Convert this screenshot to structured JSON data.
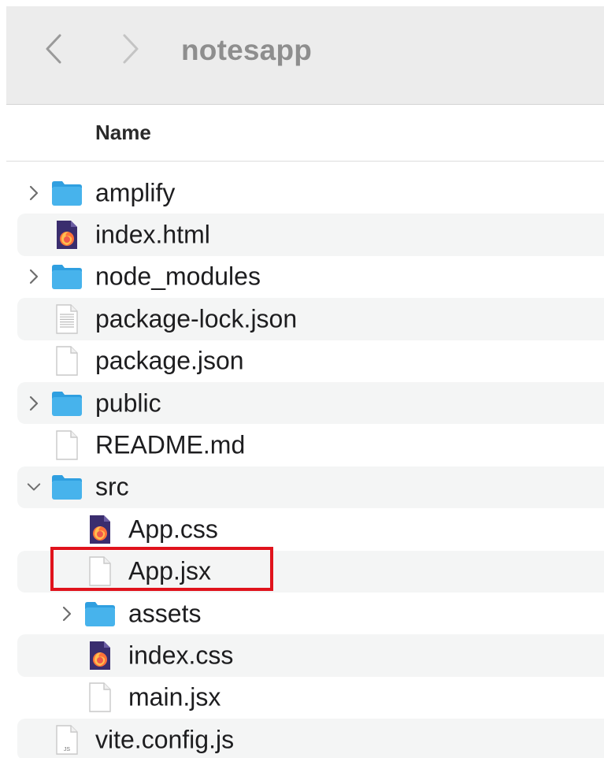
{
  "window": {
    "title": "notesapp"
  },
  "toolbar": {
    "back_icon": "chevron-left-icon",
    "forward_icon": "chevron-right-icon"
  },
  "columns": {
    "name": "Name"
  },
  "colors": {
    "folder": "#47b3ec",
    "folder_tab": "#2f9fe0",
    "firefox_doc": "#3a2d6e",
    "highlight": "#e0131c",
    "row_alt": "#f4f5f5",
    "toolbar_bg": "#ececec"
  },
  "files": [
    {
      "name": "amplify",
      "kind": "folder",
      "level": 0,
      "expanded": false
    },
    {
      "name": "index.html",
      "kind": "firefox-doc",
      "level": 0
    },
    {
      "name": "node_modules",
      "kind": "folder",
      "level": 0,
      "expanded": false
    },
    {
      "name": "package-lock.json",
      "kind": "text-doc",
      "level": 0
    },
    {
      "name": "package.json",
      "kind": "blank-doc",
      "level": 0
    },
    {
      "name": "public",
      "kind": "folder",
      "level": 0,
      "expanded": false
    },
    {
      "name": "README.md",
      "kind": "blank-doc",
      "level": 0
    },
    {
      "name": "src",
      "kind": "folder",
      "level": 0,
      "expanded": true
    },
    {
      "name": "App.css",
      "kind": "firefox-doc",
      "level": 1
    },
    {
      "name": "App.jsx",
      "kind": "blank-doc",
      "level": 1,
      "highlighted": true
    },
    {
      "name": "assets",
      "kind": "folder",
      "level": 1,
      "expanded": false
    },
    {
      "name": "index.css",
      "kind": "firefox-doc",
      "level": 1
    },
    {
      "name": "main.jsx",
      "kind": "blank-doc",
      "level": 1
    },
    {
      "name": "vite.config.js",
      "kind": "js-doc",
      "level": 0,
      "badge": "JS"
    }
  ]
}
